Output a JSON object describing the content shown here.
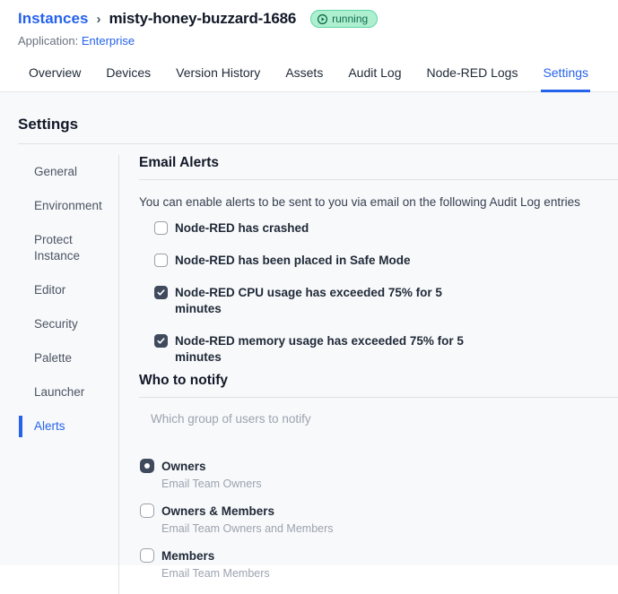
{
  "header": {
    "breadcrumb_root": "Instances",
    "breadcrumb_separator": "›",
    "instance_name": "misty-honey-buzzard-1686",
    "status_badge": "running",
    "application_label": "Application:",
    "application_name": "Enterprise"
  },
  "tabs": [
    {
      "label": "Overview",
      "active": false
    },
    {
      "label": "Devices",
      "active": false
    },
    {
      "label": "Version History",
      "active": false
    },
    {
      "label": "Assets",
      "active": false
    },
    {
      "label": "Audit Log",
      "active": false
    },
    {
      "label": "Node-RED Logs",
      "active": false
    },
    {
      "label": "Settings",
      "active": true
    }
  ],
  "page": {
    "title": "Settings"
  },
  "sidebar": {
    "items": [
      {
        "label": "General",
        "active": false
      },
      {
        "label": "Environment",
        "active": false
      },
      {
        "label": "Protect Instance",
        "active": false
      },
      {
        "label": "Editor",
        "active": false
      },
      {
        "label": "Security",
        "active": false
      },
      {
        "label": "Palette",
        "active": false
      },
      {
        "label": "Launcher",
        "active": false
      },
      {
        "label": "Alerts",
        "active": true
      }
    ]
  },
  "email_alerts": {
    "title": "Email Alerts",
    "description": "You can enable alerts to be sent to you via email on the following Audit Log entries",
    "options": [
      {
        "label": "Node-RED has crashed",
        "checked": false
      },
      {
        "label": "Node-RED has been placed in Safe Mode",
        "checked": false
      },
      {
        "label": "Node-RED CPU usage has exceeded 75% for 5 minutes",
        "checked": true
      },
      {
        "label": "Node-RED memory usage has exceeded 75% for 5 minutes",
        "checked": true
      }
    ]
  },
  "who_to_notify": {
    "title": "Who to notify",
    "description": "Which group of users to notify",
    "options": [
      {
        "label": "Owners",
        "sublabel": "Email Team Owners",
        "selected": true
      },
      {
        "label": "Owners & Members",
        "sublabel": "Email Team Owners and Members",
        "selected": false
      },
      {
        "label": "Members",
        "sublabel": "Email Team Members",
        "selected": false
      }
    ]
  },
  "colors": {
    "accent": "#2563eb",
    "control_checked": "#3f4a5c",
    "status_bg": "#aeefd0",
    "status_border": "#5bd6a4",
    "status_text": "#0e6e4c"
  }
}
